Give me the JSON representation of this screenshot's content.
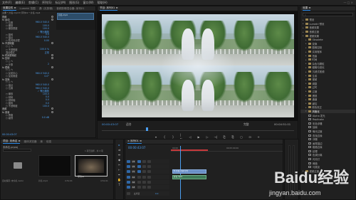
{
  "menubar": {
    "items": [
      "文件(F)",
      "编辑(E)",
      "剪辑(C)",
      "序列(S)",
      "标记(M)",
      "图形(G)",
      "窗口(W)",
      "帮助(H)"
    ],
    "right": "— □ ×"
  },
  "effect_controls": {
    "tabs": [
      "效果控件 ≡",
      "Lumetri 范围",
      "源: (无剪辑)",
      "音频剪辑混合器: 序列01"
    ],
    "header": "主要 * 片名.mp4 ▾ 序列01 * 片名.mp4",
    "rows": [
      {
        "label": "视频",
        "value": ""
      },
      {
        "label": "fx 运动",
        "value": ""
      },
      {
        "label": "○ 位置",
        "value": "960.0 540.0"
      },
      {
        "label": "○ 缩放",
        "value": "100.0"
      },
      {
        "label": "○ 缩放宽度",
        "value": "100.0"
      },
      {
        "label": "",
        "value": "✓ 等比缩放"
      },
      {
        "label": "○ 旋转",
        "value": "0.0"
      },
      {
        "label": "○ 锚点",
        "value": "960.0 540.0"
      },
      {
        "label": "○ 防闪烁滤镜",
        "value": "0.00"
      },
      {
        "label": "fx 不透明度",
        "value": ""
      },
      {
        "label": "○ ◻ ✎",
        "value": ""
      },
      {
        "label": "○ 不透明度",
        "value": "100.0 %"
      },
      {
        "label": "混合模式",
        "value": "正常"
      },
      {
        "label": "fx 时间重映射",
        "value": ""
      },
      {
        "label": "fx 复制",
        "value": ""
      },
      {
        "label": "○ ◻ ✎",
        "value": ""
      },
      {
        "label": "○ 计数",
        "value": "2"
      },
      {
        "label": "fx 镜像",
        "value": ""
      },
      {
        "label": "○ ◻ ✎",
        "value": ""
      },
      {
        "label": "○ 反射中心",
        "value": "960.0 540.0"
      },
      {
        "label": "○ 反射角度",
        "value": "0.0°"
      },
      {
        "label": "fx 变换",
        "value": ""
      },
      {
        "label": "○ ◻ ✎",
        "value": ""
      },
      {
        "label": "○ 锚点",
        "value": "960.0 540.0"
      },
      {
        "label": "○ 位置",
        "value": "960.0 540.0"
      },
      {
        "label": "",
        "value": "✓ 等比缩放"
      },
      {
        "label": "○ 缩放",
        "value": "100.0"
      },
      {
        "label": "○ 倾斜",
        "value": "0.0"
      },
      {
        "label": "○ 倾斜轴",
        "value": "0.0"
      },
      {
        "label": "○ 旋转",
        "value": "0.0"
      },
      {
        "label": "○ 不透明度",
        "value": "100.0"
      },
      {
        "label": "音频",
        "value": ""
      },
      {
        "label": "fx 音量",
        "value": ""
      },
      {
        "label": "○ 旁路",
        "value": ""
      },
      {
        "label": "○ 级别",
        "value": "0.0 dB"
      }
    ],
    "clip_label": "片名.mp4",
    "timecode": "00:00:43:07"
  },
  "program_monitor": {
    "tabs": [
      "节目: 序列01 ≡"
    ],
    "timecode_current": "00:00:43:07",
    "fit_label": "适合",
    "quality_label": "完整",
    "timecode_total": "00:04:51:01",
    "controls": [
      "▾",
      "{",
      "}",
      "|←",
      "◁",
      "▶",
      "▷",
      "→|",
      "⎗",
      "⎘",
      "◻",
      "⊡",
      "+"
    ]
  },
  "project": {
    "tabs": [
      "项目: 未命名 ≡",
      "媒体浏览器",
      "库",
      "信息"
    ],
    "file_name": "未命名.prproj",
    "count": "1 项已选择，共 4 项",
    "items": [
      {
        "label": "自动保存 (未命名 Auto)",
        "meta": ""
      },
      {
        "label": "片名.mp4",
        "meta": "4:51:01"
      },
      {
        "label": "序列01",
        "meta": "4:51:01"
      }
    ]
  },
  "tools": [
    "▸",
    "⇉",
    "⇹",
    "◆",
    "✂",
    "⊢",
    "✒",
    "✋",
    "T"
  ],
  "timeline": {
    "tabs": [
      "× 序列01 ≡"
    ],
    "timecode": "00:00:43:07",
    "ruler_marks": [
      "00:00",
      "00:05:00:00"
    ],
    "tracks": [
      {
        "name": "V3",
        "kind": "video"
      },
      {
        "name": "V2",
        "kind": "video"
      },
      {
        "name": "V1",
        "kind": "video"
      },
      {
        "name": "A1",
        "kind": "audio"
      },
      {
        "name": "A2",
        "kind": "audio"
      },
      {
        "name": "A3",
        "kind": "audio"
      },
      {
        "name": "主声道",
        "kind": "master"
      }
    ],
    "master_value": "0.0",
    "clips": [
      {
        "label": "fx 片名.mp4 [V]",
        "track": "V1"
      },
      {
        "label": "片名.mp4",
        "track": "A1"
      }
    ]
  },
  "effects": {
    "title": "效果 ≡",
    "search_placeholder": "",
    "items": [
      {
        "label": "预设",
        "level": 0,
        "folder": true
      },
      {
        "label": "Lumetri 预设",
        "level": 0,
        "folder": true
      },
      {
        "label": "音频效果",
        "level": 0,
        "folder": true
      },
      {
        "label": "音频过渡",
        "level": 0,
        "folder": true
      },
      {
        "label": "视频效果",
        "level": 0,
        "folder": true
      },
      {
        "label": "Obsolete",
        "level": 1,
        "folder": true
      },
      {
        "label": "变换",
        "level": 1,
        "folder": true
      },
      {
        "label": "图像控制",
        "level": 1,
        "folder": true
      },
      {
        "label": "实用程序",
        "level": 1,
        "folder": true
      },
      {
        "label": "扭曲",
        "level": 1,
        "folder": true
      },
      {
        "label": "时间",
        "level": 1,
        "folder": true
      },
      {
        "label": "杂色与颗粒",
        "level": 1,
        "folder": true
      },
      {
        "label": "模糊与锐化",
        "level": 1,
        "folder": true
      },
      {
        "label": "沉浸式视频",
        "level": 1,
        "folder": true
      },
      {
        "label": "生成",
        "level": 1,
        "folder": true
      },
      {
        "label": "视频",
        "level": 1,
        "folder": true
      },
      {
        "label": "调整",
        "level": 1,
        "folder": true
      },
      {
        "label": "过时",
        "level": 1,
        "folder": true
      },
      {
        "label": "过渡",
        "level": 1,
        "folder": true
      },
      {
        "label": "透视",
        "level": 1,
        "folder": true
      },
      {
        "label": "通道",
        "level": 1,
        "folder": true
      },
      {
        "label": "键控",
        "level": 1,
        "folder": true
      },
      {
        "label": "颜色校正",
        "level": 1,
        "folder": true
      },
      {
        "label": "风格化",
        "level": 1,
        "folder": true,
        "selected": true
      },
      {
        "label": "Alpha 发光",
        "level": 2,
        "folder": false
      },
      {
        "label": "Replicate",
        "level": 2,
        "folder": false
      },
      {
        "label": "彩色浮雕",
        "level": 2,
        "folder": false
      },
      {
        "label": "抽帧",
        "level": 2,
        "folder": false
      },
      {
        "label": "曝光过度",
        "level": 2,
        "folder": false
      },
      {
        "label": "查找边缘",
        "level": 2,
        "folder": false
      },
      {
        "label": "浮雕",
        "level": 2,
        "folder": false
      },
      {
        "label": "画笔描边",
        "level": 2,
        "folder": false
      },
      {
        "label": "粗糙边缘",
        "level": 2,
        "folder": false
      },
      {
        "label": "纹理",
        "level": 2,
        "folder": false
      },
      {
        "label": "色调分离",
        "level": 2,
        "folder": false
      },
      {
        "label": "闪光灯",
        "level": 2,
        "folder": false
      },
      {
        "label": "阈值",
        "level": 2,
        "folder": false
      },
      {
        "label": "马赛克",
        "level": 2,
        "folder": false
      },
      {
        "label": "视频过渡",
        "level": 0,
        "folder": true
      }
    ]
  },
  "watermark": {
    "brand": "Baidu经验",
    "url": "jingyan.baidu.com"
  }
}
